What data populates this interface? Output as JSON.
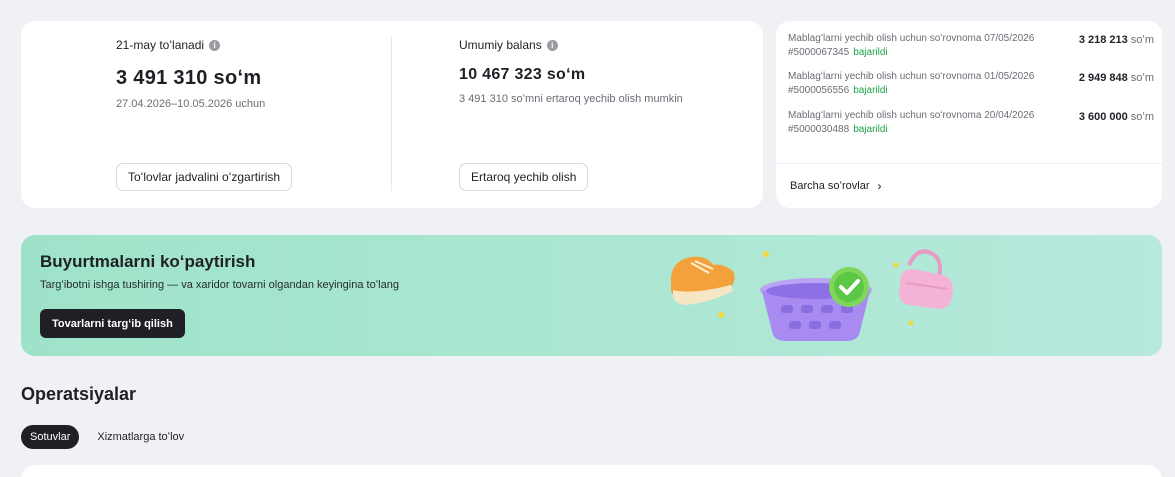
{
  "balance": {
    "left": {
      "label": "21-may toʻlanadi",
      "amount": "3 491 310 soʻm",
      "period": "27.04.2026–10.05.2026 uchun",
      "button": "Toʻlovlar jadvalini oʻzgartirish"
    },
    "right": {
      "label": "Umumiy balans",
      "amount": "10 467 323 soʻm",
      "note": "3 491 310 soʻmni ertaroq yechib olish mumkin",
      "button": "Ertaroq yechib olish"
    },
    "info_icon": "info-icon"
  },
  "withdrawals": {
    "items": [
      {
        "title": "Mablagʻlarni yechib olish uchun soʻrovnoma 07/05/2026",
        "id": "#5000067345",
        "status": "bajarildi",
        "amount": "3 218 213",
        "currency": "soʻm"
      },
      {
        "title": "Mablagʻlarni yechib olish uchun soʻrovnoma 01/05/2026",
        "id": "#5000056556",
        "status": "bajarildi",
        "amount": "2 949 848",
        "currency": "soʻm"
      },
      {
        "title": "Mablagʻlarni yechib olish uchun soʻrovnoma 20/04/2026",
        "id": "#5000030488",
        "status": "bajarildi",
        "amount": "3 600 000",
        "currency": "soʻm"
      }
    ],
    "all_link": "Barcha soʻrovlar",
    "status_color": "#1fa347"
  },
  "promo": {
    "title": "Buyurtmalarni koʻpaytirish",
    "text": "Targʻibotni ishga tushiring — va xaridor tovarni olgandan keyingina toʻlang",
    "button": "Tovarlarni targʻib qilish"
  },
  "operations": {
    "title": "Operatsiyalar",
    "tabs": [
      {
        "label": "Sotuvlar",
        "active": true
      },
      {
        "label": "Xizmatlarga toʻlov",
        "active": false
      }
    ]
  }
}
